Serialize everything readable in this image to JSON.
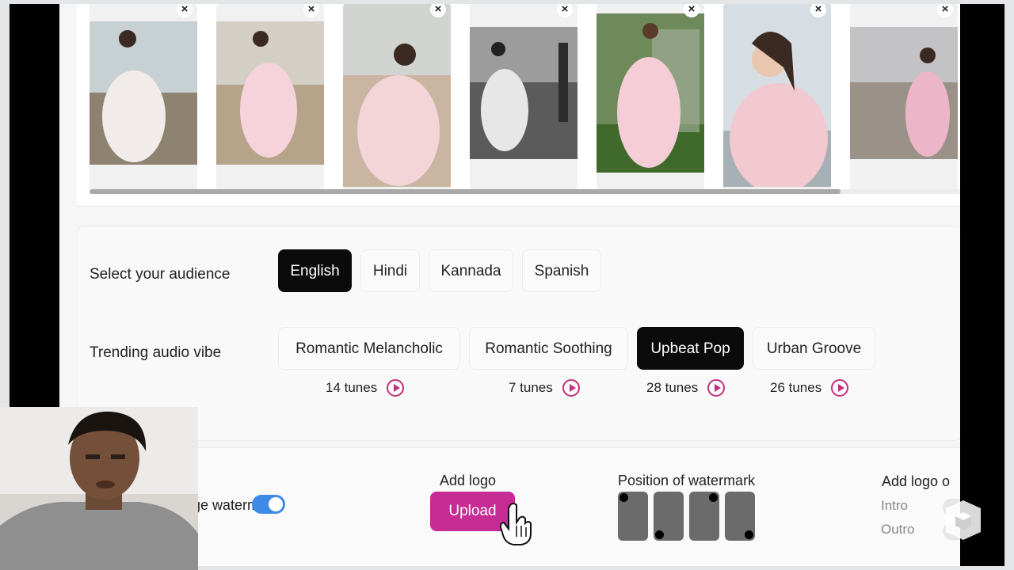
{
  "gallery": {
    "close_glyph": "×",
    "thumbnails": [
      {
        "name": "photo-1",
        "palette": [
          "#c7d0d3",
          "#8e8270",
          "#f1ece9"
        ]
      },
      {
        "name": "photo-2",
        "palette": [
          "#d4cfc6",
          "#b5a38a",
          "#f6d3da"
        ]
      },
      {
        "name": "photo-3",
        "palette": [
          "#d2d4d2",
          "#c9b5a2",
          "#f3d5d8"
        ]
      },
      {
        "name": "photo-4",
        "palette": [
          "#9c9c9c",
          "#5b5b5b",
          "#e7e7e7"
        ]
      },
      {
        "name": "photo-5",
        "palette": [
          "#6f8a5a",
          "#3f6a2b",
          "#f4cdd6"
        ]
      },
      {
        "name": "photo-6",
        "palette": [
          "#d7dee3",
          "#a7b0b4",
          "#f2c9d0"
        ]
      },
      {
        "name": "photo-7",
        "palette": [
          "#c3c3c6",
          "#9a9288",
          "#ecb6c8"
        ]
      }
    ]
  },
  "audience": {
    "label": "Select your audience",
    "options": [
      "English",
      "Hindi",
      "Kannada",
      "Spanish"
    ],
    "selected": "English"
  },
  "audio": {
    "label": "Trending audio vibe",
    "options": [
      {
        "label": "Romantic Melancholic",
        "tunes": "14 tunes"
      },
      {
        "label": "Romantic Soothing",
        "tunes": "7 tunes"
      },
      {
        "label": "Upbeat Pop",
        "tunes": "28 tunes"
      },
      {
        "label": "Urban Groove",
        "tunes": "26 tunes"
      }
    ],
    "selected": "Upbeat Pop"
  },
  "branding": {
    "watermark_label": "ge watermark",
    "watermark_enabled": true,
    "add_logo_label": "Add logo",
    "upload_label": "Upload",
    "position_label": "Position of watermark",
    "add_logo_on_label": "Add logo o",
    "intro_label": "Intro",
    "outro_label": "Outro"
  },
  "colors": {
    "accent": "#c62c94",
    "play_icon": "#c1307e",
    "toggle_on": "#3f8ae6",
    "selected_pill": "#0b0b0b"
  }
}
